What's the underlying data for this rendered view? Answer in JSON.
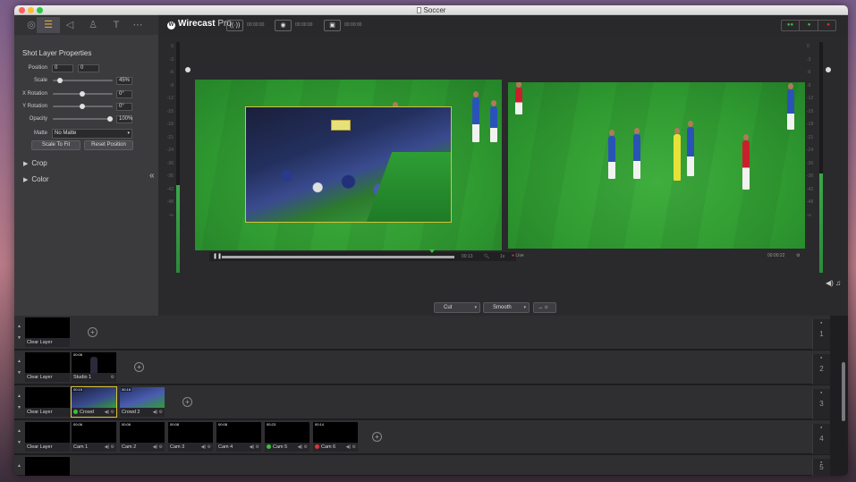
{
  "window": {
    "title": "Soccer"
  },
  "traffic_lights": {
    "close": "#fc5f57",
    "minimize": "#fdbc2e",
    "zoom": "#28c840"
  },
  "brand": {
    "name": "Wirecast",
    "suffix": "Pro"
  },
  "toolbar": {
    "stream_time": "00:00:00",
    "record_time": "00:00:00",
    "iso_time": "00:00:00",
    "stream_icon": "broadcast-icon",
    "record_icon": "record-icon",
    "iso_icon": "iso-record-icon",
    "status_colors": [
      "#3ec13e",
      "#3ec13e",
      "#e0333a"
    ]
  },
  "left_panel": {
    "tabs": [
      "source-icon",
      "layer-properties-icon",
      "audio-icon",
      "user-icon",
      "text-icon",
      "more-icon"
    ],
    "title": "Shot Layer Properties",
    "position": {
      "label": "Position",
      "x": "0",
      "y": "0"
    },
    "scale": {
      "label": "Scale",
      "value": "45%",
      "level": 0.45
    },
    "x_rotation": {
      "label": "X Rotation",
      "value": "0°",
      "level": 0.5
    },
    "y_rotation": {
      "label": "Y Rotation",
      "value": "0°",
      "level": 0.5
    },
    "opacity": {
      "label": "Opacity",
      "value": "100%",
      "level": 1.0
    },
    "matte": {
      "label": "Matte",
      "value": "No Matte"
    },
    "scale_to_fit": "Scale To Fit",
    "reset_position": "Reset Position",
    "crop": "Crop",
    "color": "Color"
  },
  "preview": {
    "db_scale": [
      "0",
      "-3",
      "-6",
      "-9",
      "-12",
      "-15",
      "-18",
      "-21",
      "-24",
      "-30",
      "-36",
      "-42",
      "-48",
      "-∞"
    ],
    "transport_time": "00:13",
    "transport_speed": "1x",
    "left_meter_level": 0.38,
    "right_meter_level": 0.43
  },
  "live": {
    "status": "Live",
    "time": "00:00:22"
  },
  "transition": {
    "cut": "Cut",
    "smooth": "Smooth",
    "go": "→"
  },
  "layers": [
    {
      "number": "1",
      "clear": "Clear Layer",
      "shots": []
    },
    {
      "number": "2",
      "clear": "Clear Layer",
      "shots": [
        {
          "name": "Studio 1",
          "duration": "00:06"
        }
      ]
    },
    {
      "number": "3",
      "clear": "Clear Layer",
      "shots": [
        {
          "name": "Crowd",
          "duration": "00:15",
          "status": "#3ec13e"
        },
        {
          "name": "Crowd 2",
          "duration": "00:16"
        }
      ]
    },
    {
      "number": "4",
      "clear": "Clear Layer",
      "shots": [
        {
          "name": "Cam 1",
          "duration": "00:06"
        },
        {
          "name": "Cam 2",
          "duration": "00:06"
        },
        {
          "name": "Cam 3",
          "duration": "00:08"
        },
        {
          "name": "Cam 4",
          "duration": "00:08"
        },
        {
          "name": "Cam 5",
          "duration": "00:23",
          "status": "#3ec13e"
        },
        {
          "name": "Cam 6",
          "duration": "00:14",
          "status": "#e0333a"
        }
      ]
    },
    {
      "number": "5",
      "clear": "Clear Layer",
      "shots": []
    }
  ]
}
